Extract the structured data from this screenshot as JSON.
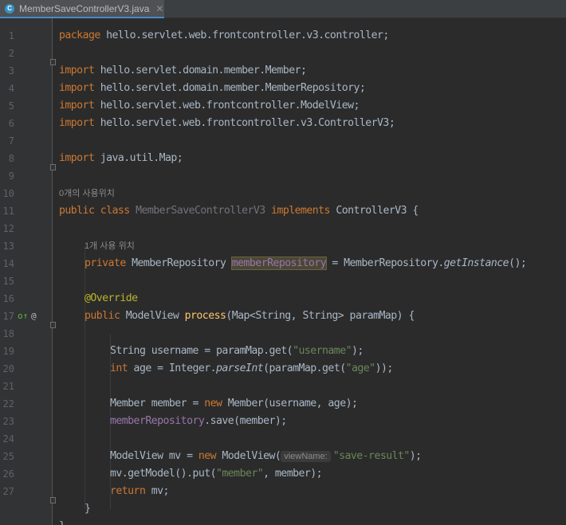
{
  "tab": {
    "filename": "MemberSaveControllerV3.java",
    "icon": "java-class-icon",
    "close_glyph": "✕"
  },
  "hints": {
    "class_usage": "0개의 사용위치",
    "field_usage": "1개 사용 위치",
    "param_name": "viewName:"
  },
  "gutter": {
    "line_numbers": [
      "1",
      "2",
      "3",
      "4",
      "5",
      "6",
      "7",
      "8",
      "9",
      "10",
      "11",
      "12",
      "13",
      "14",
      "15",
      "16",
      "17",
      "18",
      "19",
      "20",
      "21",
      "22",
      "23",
      "24",
      "25",
      "26",
      "27"
    ],
    "implements_marker": "o↑",
    "override_marker": "@"
  },
  "code": {
    "l1_kw": "package",
    "l1_rest": " hello.servlet.web.frontcontroller.v3.controller;",
    "l3_kw": "import",
    "l3_rest": " hello.servlet.domain.member.Member;",
    "l4_kw": "import",
    "l4_rest": " hello.servlet.domain.member.MemberRepository;",
    "l5_kw": "import",
    "l5_rest": " hello.servlet.web.frontcontroller.ModelView;",
    "l6_kw": "import",
    "l6_rest": " hello.servlet.web.frontcontroller.v3.ControllerV3;",
    "l8_kw": "import",
    "l8_rest": " java.util.Map;",
    "l10_kw1": "public class ",
    "l10_cls": "MemberSaveControllerV3",
    "l10_kw2": " implements",
    "l10_rest": " ControllerV3 {",
    "l12_kw": "private",
    "l12_type": " MemberRepository ",
    "l12_fld": "memberRepository",
    "l12_mid": " = MemberRepository.",
    "l12_call": "getInstance",
    "l12_end": "();",
    "l14_ann": "@Override",
    "l15_kw": "public",
    "l15_type": " ModelView ",
    "l15_meth": "process",
    "l15_rest": "(Map<String, String> paramMap) {",
    "l17_a": "String username = paramMap.get(",
    "l17_str": "\"username\"",
    "l17_b": ");",
    "l18_kw": "int",
    "l18_a": " age = Integer.",
    "l18_call": "parseInt",
    "l18_b": "(paramMap.get(",
    "l18_str": "\"age\"",
    "l18_c": "));",
    "l20_a": "Member member = ",
    "l20_kw": "new",
    "l20_b": " Member(username, age);",
    "l21_fld": "memberRepository",
    "l21_rest": ".save(member);",
    "l23_a": "ModelView mv = ",
    "l23_kw": "new",
    "l23_b": " ModelView(",
    "l23_str": "\"save-result\"",
    "l23_c": ");",
    "l24_a": "mv.getModel().put(",
    "l24_str": "\"member\"",
    "l24_b": ", member);",
    "l25_kw": "return",
    "l25_rest": " mv;",
    "l26": "}",
    "l27": "}"
  },
  "colors": {
    "keyword": "#cc7832",
    "string": "#6a8759",
    "annotation": "#bbb529",
    "field": "#9876aa",
    "method": "#ffc66d",
    "background": "#2b2b2b"
  }
}
